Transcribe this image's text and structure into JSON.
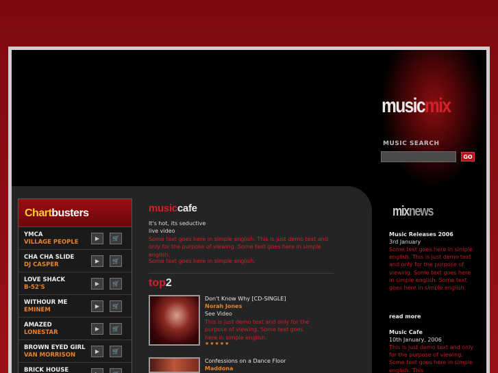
{
  "logo": {
    "word1": "music",
    "word2": "mix"
  },
  "search": {
    "label": "MUSIC SEARCH",
    "value": "",
    "go": "GO"
  },
  "chartbusters": {
    "title_part1": "Chart",
    "title_part2": "busters",
    "items": [
      {
        "song": "YMCA",
        "artist": "VILLAGE PEOPLE"
      },
      {
        "song": "CHA CHA SLIDE",
        "artist": "DJ CASPER"
      },
      {
        "song": "LOVE SHACK",
        "artist": "B-52'S"
      },
      {
        "song": "WITHOUR ME",
        "artist": "EMINEM"
      },
      {
        "song": "AMAZED",
        "artist": "LONESTAR"
      },
      {
        "song": "BROWN EYED GIRL",
        "artist": "VAN MORRISON"
      },
      {
        "song": "BRICK HOUSE",
        "artist": ""
      }
    ]
  },
  "musiccafe": {
    "title_part1": "music",
    "title_part2": "cafe",
    "line1": "It's hot, its seductive",
    "line2": "live video",
    "paragraph": "Some text goes here in simple english. This is just demo text and only for the purpose of viewing. Some text goes here in simple english.",
    "paragraph2": "Some text goes here in simple english."
  },
  "top2": {
    "title_part1": "top",
    "title_part2": "2",
    "items": [
      {
        "title": "Don't Know Why [CD-SINGLE]",
        "artist": "Norah Jones",
        "sub": "See Video",
        "desc": "This is just demo text and only for the purpose of viewing. Some text goes here in simple english.",
        "stars": "★★★★★"
      },
      {
        "title": "Confessions on a Dance Floor",
        "artist": "Maddona"
      }
    ]
  },
  "mixnews": {
    "title_part1": "mix",
    "title_part2": "news",
    "items": [
      {
        "heading": "Music Releases 2006",
        "date": "3rd January",
        "text": "Some text goes here in simple english. This is just demo text and only for the purpose of viewing. Some text goes here in simple english. Some text goes here in simple english.",
        "more": "read more"
      },
      {
        "heading": "Music Cafe",
        "date": "10th January, 2006",
        "text": "This is just demo text and only for the purpose of viewing. Some text goes here in simple english. This"
      }
    ]
  },
  "colors": {
    "accent_red": "#d5202a",
    "accent_orange": "#e8832a",
    "background_red": "#8c0f14"
  }
}
